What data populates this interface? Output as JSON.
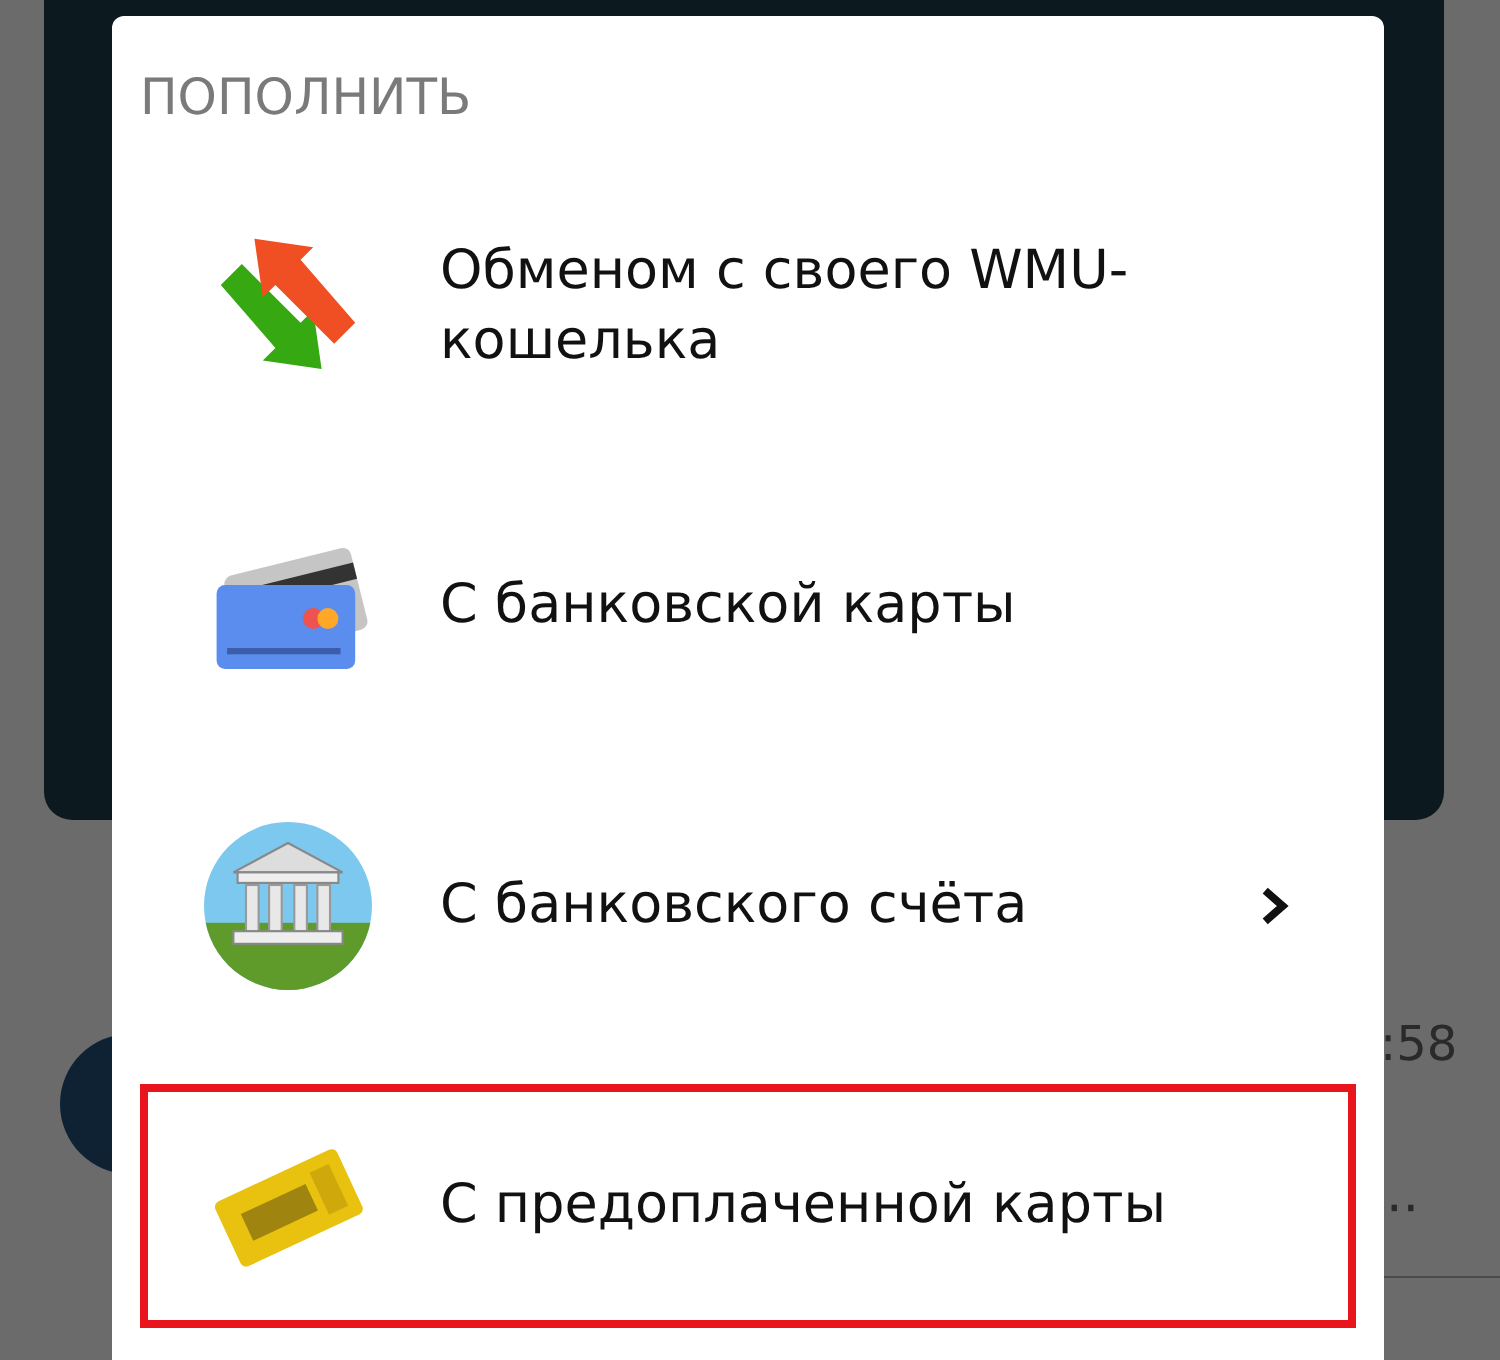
{
  "background": {
    "time": ":58",
    "more": "··"
  },
  "dialog": {
    "title": "ПОПОЛНИТЬ",
    "items": [
      {
        "kind": "exchange",
        "label": "Обменом с своего WMU-\nкошелька",
        "has_submenu": false,
        "highlighted": false
      },
      {
        "kind": "card",
        "label": "С банковской карты",
        "has_submenu": false,
        "highlighted": false
      },
      {
        "kind": "bank",
        "label": "С банковского счёта",
        "has_submenu": true,
        "highlighted": false
      },
      {
        "kind": "prepaid",
        "label": "С предоплаченной карты",
        "has_submenu": false,
        "highlighted": true
      }
    ]
  }
}
